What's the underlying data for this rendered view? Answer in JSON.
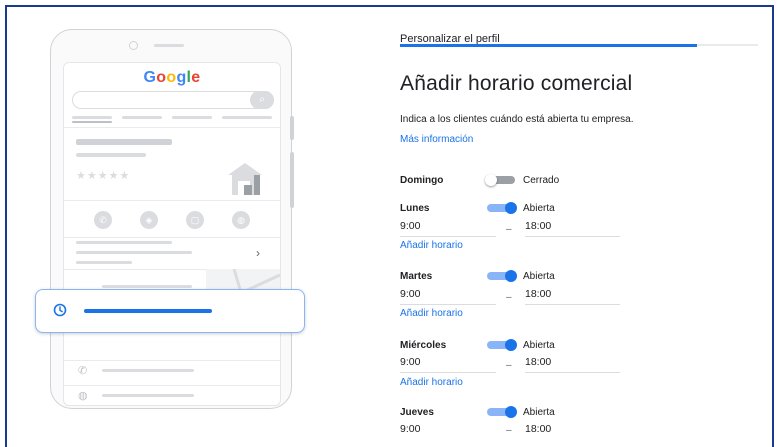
{
  "illustration": {
    "logo_text": "Google",
    "search_button_glyph": "⌕",
    "stars": "★★★★★",
    "action_icons": [
      "phone-icon",
      "directions-icon",
      "save-icon",
      "website-icon"
    ],
    "chevron": "›"
  },
  "progress": {
    "step_label": "Personalizar el perfil",
    "fraction": 0.83
  },
  "page": {
    "heading": "Añadir horario comercial",
    "description": "Indica a los clientes cuándo está abierta tu empresa.",
    "more_info": "Más información"
  },
  "days": [
    {
      "name": "Domingo",
      "open": false,
      "status": "Cerrado"
    },
    {
      "name": "Lunes",
      "open": true,
      "status": "Abierta",
      "open_time": "9:00",
      "close_time": "18:00",
      "dash": "–",
      "add_label": "Añadir horario"
    },
    {
      "name": "Martes",
      "open": true,
      "status": "Abierta",
      "open_time": "9:00",
      "close_time": "18:00",
      "dash": "–",
      "add_label": "Añadir horario"
    },
    {
      "name": "Miércoles",
      "open": true,
      "status": "Abierta",
      "open_time": "9:00",
      "close_time": "18:00",
      "dash": "–",
      "add_label": "Añadir horario"
    },
    {
      "name": "Jueves",
      "open": true,
      "status": "Abierta",
      "open_time": "9:00",
      "close_time": "18:00",
      "dash": "–"
    }
  ],
  "colors": {
    "accent": "#1a73e8",
    "toggle_track_on": "#8ab4f8",
    "frame_border": "#1a3a8f"
  }
}
